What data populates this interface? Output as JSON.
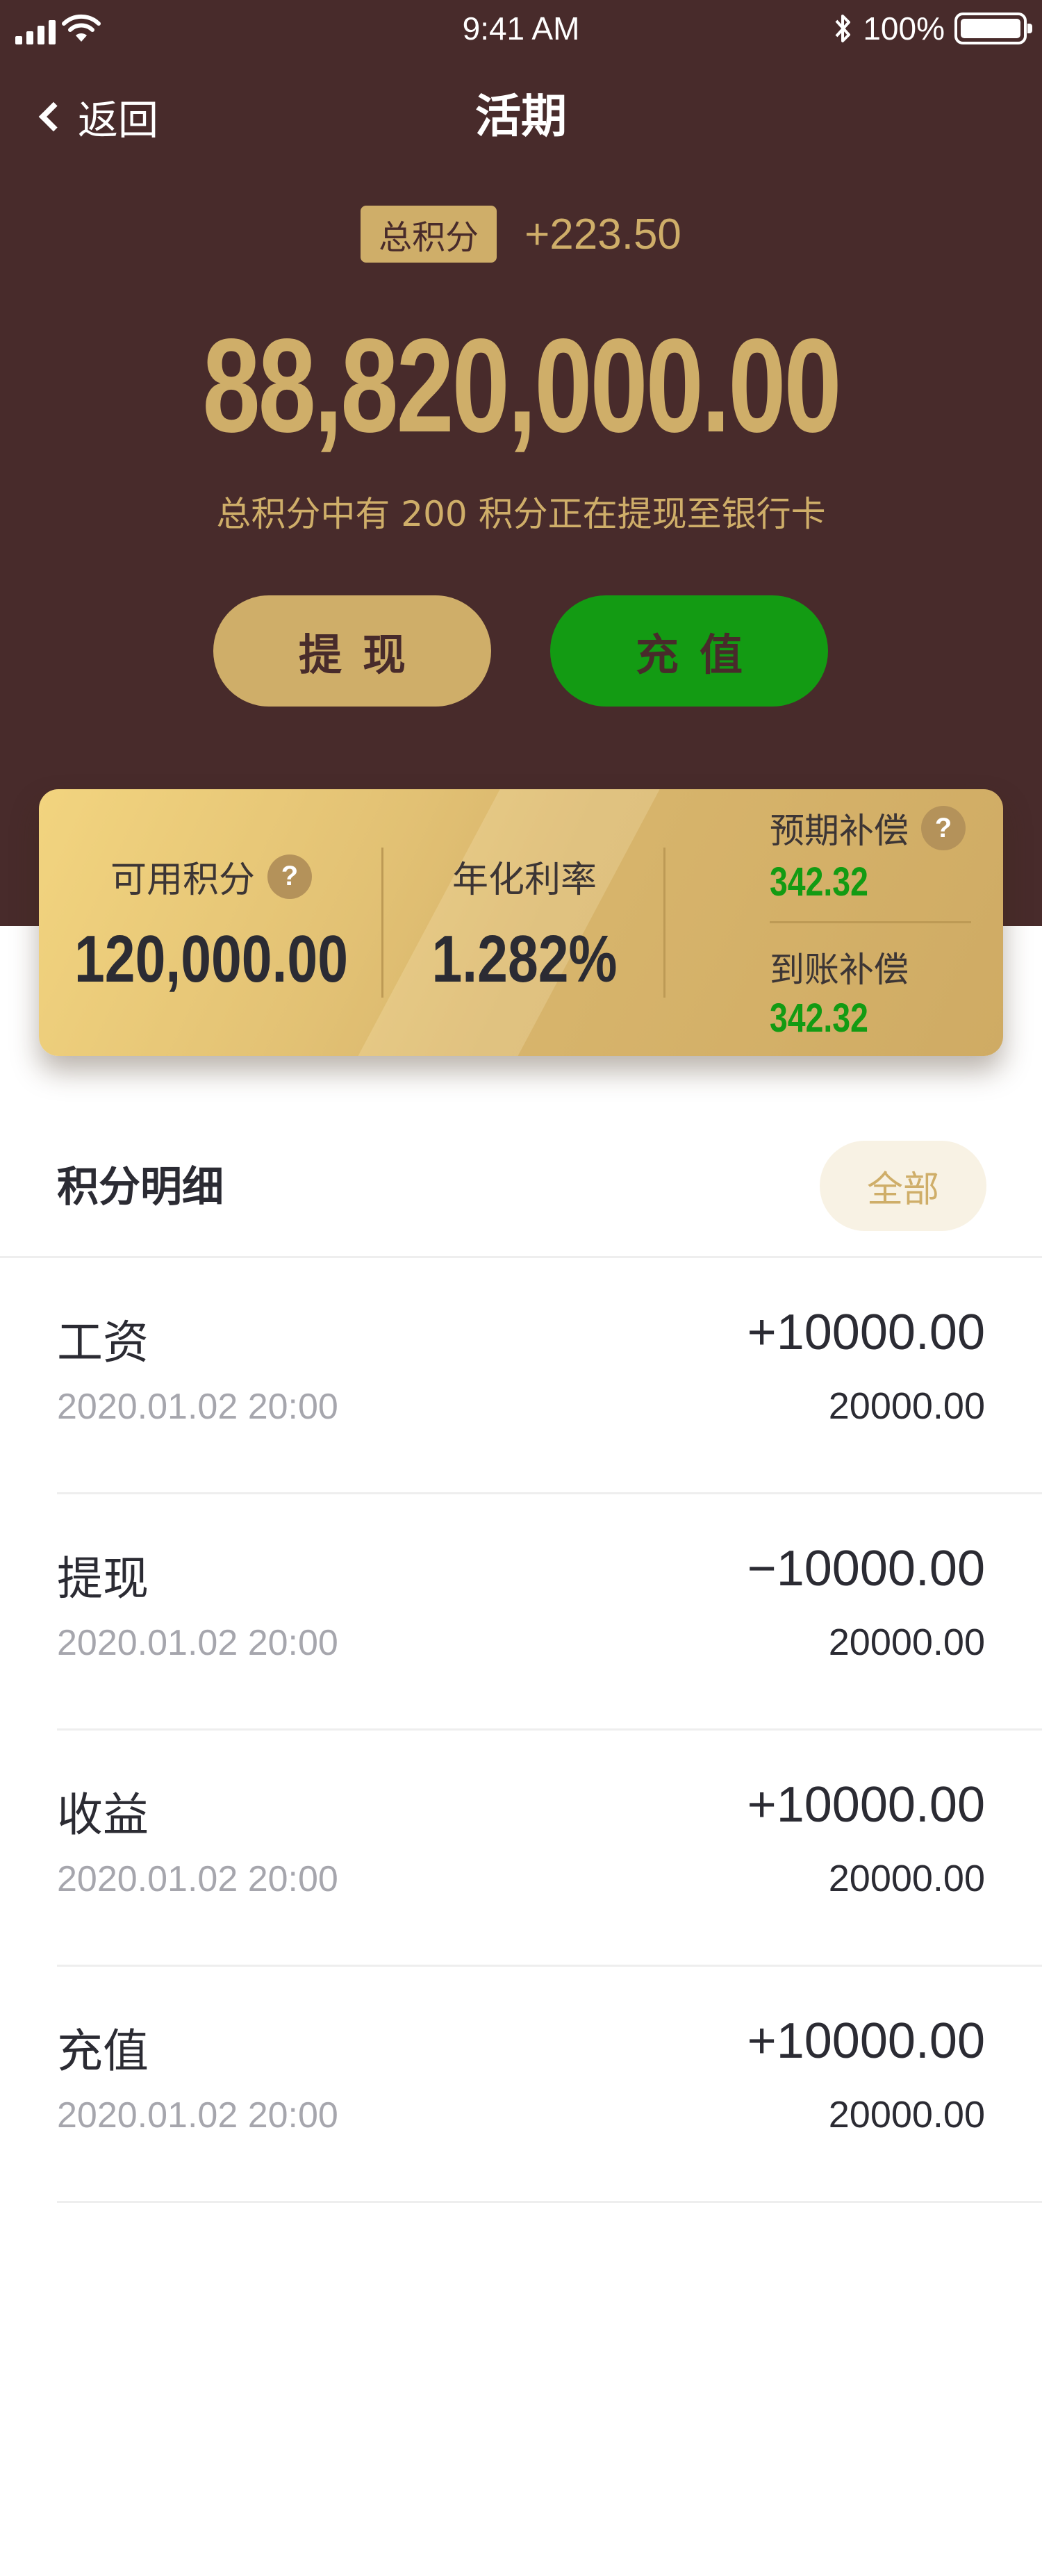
{
  "status_bar": {
    "time": "9:41 AM",
    "battery": "100%",
    "battery_level": 1.0
  },
  "nav": {
    "back_label": "返回",
    "title": "活期"
  },
  "summary": {
    "badge": "总积分",
    "change": "+223.50",
    "total": "88,820,000.00",
    "note": "总积分中有 200 积分正在提现至银行卡"
  },
  "actions": {
    "withdraw": "提现",
    "recharge": "充值"
  },
  "card": {
    "available_label": "可用积分",
    "available_value": "120,000.00",
    "rate_label": "年化利率",
    "rate_value": "1.282%",
    "expected_label": "预期补偿",
    "expected_value": "342.32",
    "received_label": "到账补偿",
    "received_value": "342.32"
  },
  "details": {
    "title": "积分明细",
    "filter": "全部",
    "items": [
      {
        "name": "工资",
        "date": "2020.01.02 20:00",
        "amount": "+10000.00",
        "balance": "20000.00"
      },
      {
        "name": "提现",
        "date": "2020.01.02 20:00",
        "amount": "−10000.00",
        "balance": "20000.00"
      },
      {
        "name": "收益",
        "date": "2020.01.02 20:00",
        "amount": "+10000.00",
        "balance": "20000.00"
      },
      {
        "name": "充值",
        "date": "2020.01.02 20:00",
        "amount": "+10000.00",
        "balance": "20000.00"
      }
    ]
  },
  "colors": {
    "header_bg": "#482b2b",
    "gold": "#cfae69",
    "green": "#139b13",
    "text_dark": "#2b2b33",
    "text_gray": "#a6a6ad"
  },
  "icons": [
    "signal-icon",
    "wifi-icon",
    "bluetooth-icon",
    "battery-icon",
    "back-chevron-icon",
    "help-icon"
  ]
}
